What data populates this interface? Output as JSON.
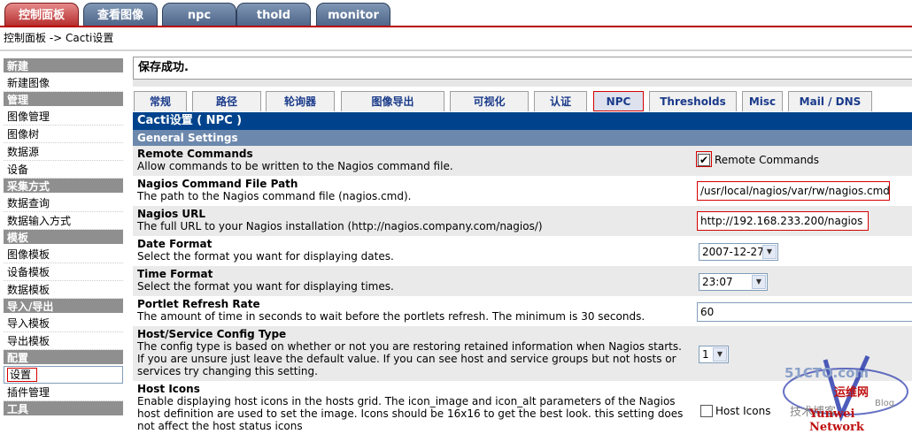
{
  "top_tabs": [
    {
      "label": "控制面板",
      "active": true
    },
    {
      "label": "查看图像",
      "active": false
    },
    {
      "label": "npc",
      "active": false
    },
    {
      "label": "thold",
      "active": false
    },
    {
      "label": "monitor",
      "active": false
    }
  ],
  "breadcrumb": "控制面板 -> Cacti设置",
  "sidebar": {
    "sections": [
      {
        "header": "新建",
        "items": [
          "新建图像"
        ]
      },
      {
        "header": "管理",
        "items": [
          "图像管理",
          "图像树",
          "数据源",
          "设备"
        ]
      },
      {
        "header": "采集方式",
        "items": [
          "数据查询",
          "数据输入方式"
        ]
      },
      {
        "header": "模板",
        "items": [
          "图像模板",
          "设备模板",
          "数据模板"
        ]
      },
      {
        "header": "导入/导出",
        "items": [
          "导入模板",
          "导出模板"
        ]
      },
      {
        "header": "配置",
        "items": [
          "设置",
          "插件管理"
        ]
      },
      {
        "header": "工具",
        "items": []
      }
    ],
    "selected": "设置"
  },
  "message": "保存成功.",
  "settings_tabs": [
    "常规",
    "路径",
    "轮询器",
    "图像导出",
    "可视化",
    "认证",
    "NPC",
    "Thresholds",
    "Misc",
    "Mail / DNS"
  ],
  "active_settings_tab": "NPC",
  "table_title": "Cacti设置 ( NPC )",
  "section_header": "General Settings",
  "settings": [
    {
      "label": "Remote Commands",
      "desc": "Allow commands to be written to the Nagios command file.",
      "control": "checkbox",
      "checked": true,
      "control_label": "Remote Commands"
    },
    {
      "label": "Nagios Command File Path",
      "desc": "The path to the Nagios command file (nagios.cmd).",
      "control": "text",
      "value": "/usr/local/nagios/var/rw/nagios.cmd"
    },
    {
      "label": "Nagios URL",
      "desc": "The full URL to your Nagios installation (http://nagios.company.com/nagios/)",
      "control": "text",
      "value": "http://192.168.233.200/nagios"
    },
    {
      "label": "Date Format",
      "desc": "Select the format you want for displaying dates.",
      "control": "select",
      "value": "2007-12-27"
    },
    {
      "label": "Time Format",
      "desc": "Select the format you want for displaying times.",
      "control": "select",
      "value": "23:07"
    },
    {
      "label": "Portlet Refresh Rate",
      "desc": "The amount of time in seconds to wait before the portlets refresh. The minimum is 30 seconds.",
      "control": "text",
      "value": "60"
    },
    {
      "label": "Host/Service Config Type",
      "desc": "The config type is based on whether or not you are restoring retained information when Nagios starts. If you are unsure just leave the default value. If you can see host and service groups but not hosts or services try changing this setting.",
      "control": "select",
      "value": "1"
    },
    {
      "label": "Host Icons",
      "desc": "Enable displaying host icons in the hosts grid. The icon_image and icon_alt parameters of the Nagios host definition are used to set the image. Icons should be 16x16 to get the best look. this setting does not affect the host status icons",
      "control": "checkbox",
      "checked": false,
      "control_label": "Host Icons"
    }
  ],
  "watermark": {
    "site": "51CTO.com",
    "cn_text": "技术博客",
    "blog": "Blog",
    "brand": "运维网",
    "brand_en": "Yunwei Network"
  },
  "colors": {
    "table_title_bg": "#00438c",
    "section_bg": "#6d88ad",
    "highlight": "#d40000",
    "tab_active_top": "#b52a2a"
  }
}
